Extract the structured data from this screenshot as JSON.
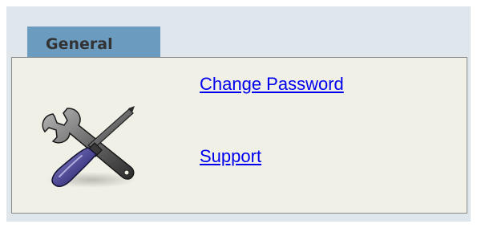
{
  "section": {
    "tab_label": "General",
    "icon": "tools-icon",
    "links": {
      "change_password": "Change Password",
      "support": "Support"
    }
  },
  "colors": {
    "background": "#dfe6ec",
    "tab": "#6b9bbf",
    "panel": "#f1f0e7",
    "link": "#0000ee"
  }
}
